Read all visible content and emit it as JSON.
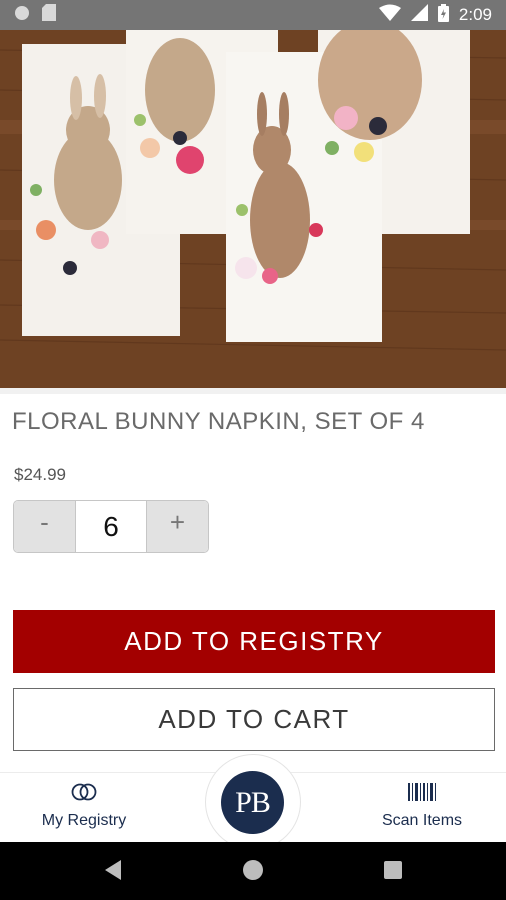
{
  "status_bar": {
    "time": "2:09"
  },
  "product": {
    "title": "FLORAL BUNNY NAPKIN, SET OF 4",
    "price": "$24.99",
    "quantity": "6",
    "decrement_label": "-",
    "increment_label": "+"
  },
  "actions": {
    "add_to_registry": "ADD TO REGISTRY",
    "add_to_cart": "ADD TO CART"
  },
  "bottom_nav": {
    "registry_label": "My Registry",
    "logo_text": "PB",
    "scan_label": "Scan Items"
  },
  "colors": {
    "brand_red": "#a30000",
    "brand_navy": "#1b2d4e"
  },
  "icons": [
    "record-icon",
    "sd-card-icon",
    "wifi-icon",
    "cell-signal-icon",
    "battery-icon",
    "rings-icon",
    "barcode-icon",
    "back-icon",
    "home-icon",
    "recents-icon"
  ]
}
